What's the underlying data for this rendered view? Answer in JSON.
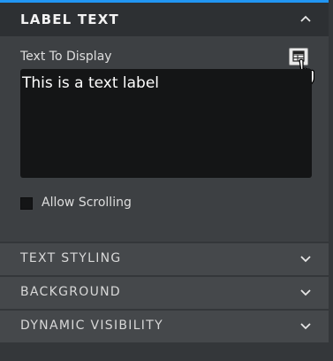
{
  "panel": {
    "accent_color": "#2196f3",
    "label_text": {
      "title": "LABEL TEXT",
      "expanded": true,
      "chevron": "chevron-up-icon",
      "text_to_display_label": "Text To Display",
      "text_value": "This is a text label",
      "picker_icon": "data-binding-picker-icon",
      "allow_scrolling_label": "Allow Scrolling",
      "allow_scrolling_checked": false
    },
    "sections": [
      {
        "title": "TEXT STYLING",
        "chevron": "chevron-down-icon"
      },
      {
        "title": "BACKGROUND",
        "chevron": "chevron-down-icon"
      },
      {
        "title": "DYNAMIC VISIBILITY",
        "chevron": "chevron-down-icon"
      }
    ]
  }
}
